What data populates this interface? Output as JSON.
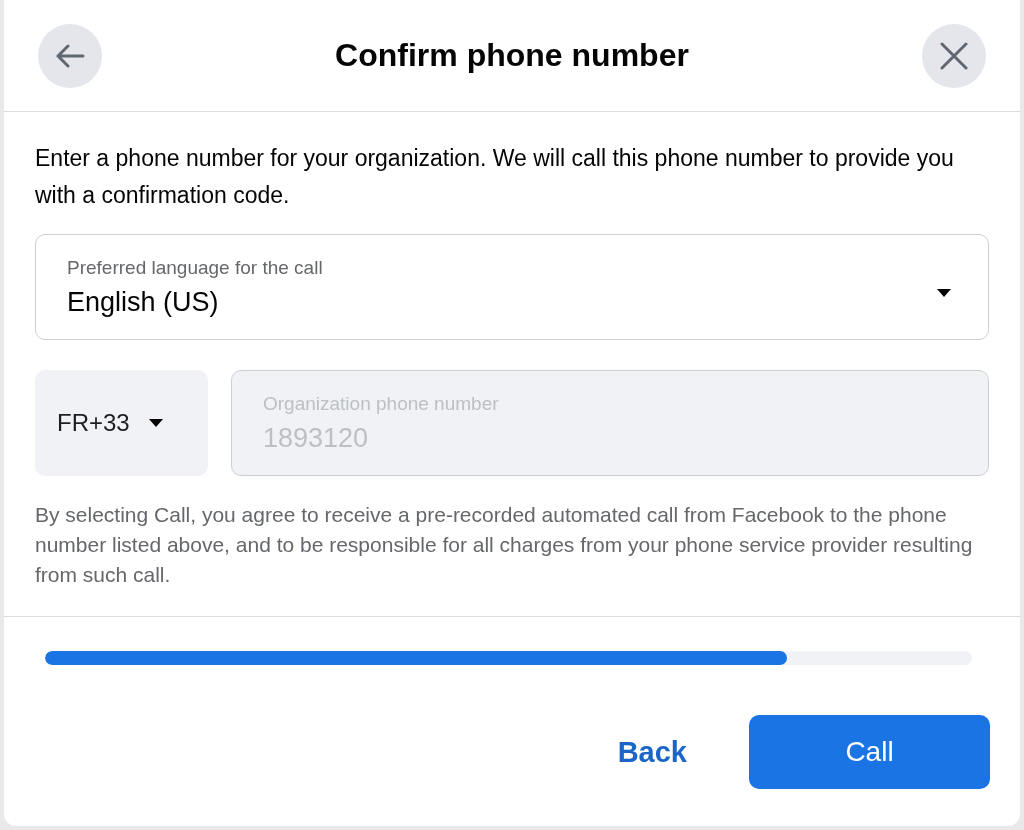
{
  "dialog": {
    "title": "Confirm phone number"
  },
  "intro": "Enter a phone number for your organization. We will call this phone number to provide you with a confirmation code.",
  "language_select": {
    "label": "Preferred language for the call",
    "value": "English (US)"
  },
  "country_code": {
    "value": "FR+33"
  },
  "phone_field": {
    "placeholder": "Organization phone number",
    "value": "1893120",
    "disabled": true
  },
  "disclaimer": "By selecting Call, you agree to receive a pre-recorded automated call from Facebook to the phone number listed above, and to be responsible for all charges from your phone service provider resulting from such call.",
  "progress": {
    "level": 0.8
  },
  "buttons": [
    {
      "label": "Back",
      "kind": "link"
    },
    {
      "label": "Call",
      "kind": "primary"
    }
  ]
}
